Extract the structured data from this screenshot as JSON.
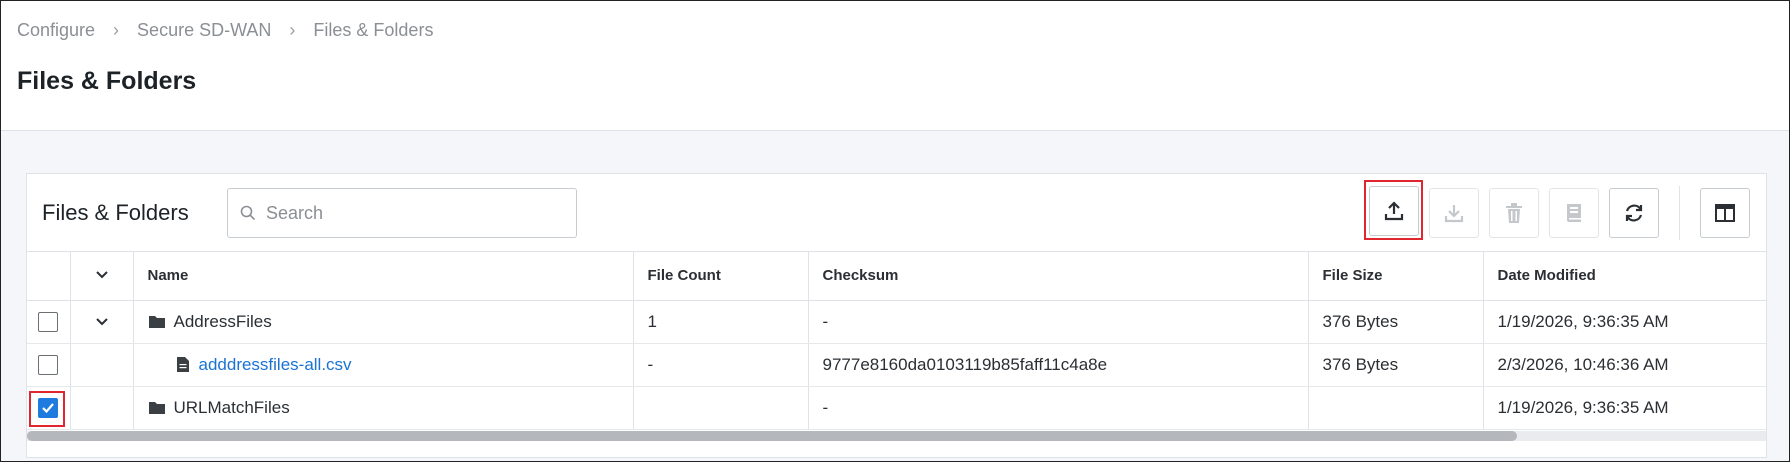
{
  "breadcrumb": [
    "Configure",
    "Secure SD-WAN",
    "Files & Folders"
  ],
  "page_title": "Files & Folders",
  "card": {
    "title": "Files & Folders",
    "search_placeholder": "Search"
  },
  "toolbar": {
    "buttons": [
      {
        "name": "upload",
        "icon": "upload-icon",
        "enabled": true,
        "highlighted": true
      },
      {
        "name": "download",
        "icon": "download-icon",
        "enabled": false
      },
      {
        "name": "delete",
        "icon": "trash-icon",
        "enabled": false
      },
      {
        "name": "view",
        "icon": "book-icon",
        "enabled": false
      },
      {
        "name": "refresh",
        "icon": "refresh-icon",
        "enabled": true
      },
      {
        "name": "columns",
        "icon": "column-layout-icon",
        "enabled": true
      }
    ]
  },
  "table": {
    "columns": [
      "Name",
      "File Count",
      "Checksum",
      "File Size",
      "Date Modified"
    ],
    "rows": [
      {
        "checked": false,
        "expandable": true,
        "type": "folder",
        "name": "AddressFiles",
        "file_count": "1",
        "checksum": "-",
        "file_size": "376 Bytes",
        "date_modified": "1/19/2026, 9:36:35 AM"
      },
      {
        "checked": false,
        "expandable": false,
        "type": "file",
        "name": "adddressfiles-all.csv",
        "file_count": "-",
        "checksum": "9777e8160da0103119b85faff11c4a8e",
        "file_size": "376 Bytes",
        "date_modified": "2/3/2026, 10:46:36 AM"
      },
      {
        "checked": true,
        "expandable": false,
        "type": "folder",
        "name": "URLMatchFiles",
        "file_count": "",
        "checksum": "-",
        "file_size": "",
        "date_modified": "1/19/2026, 9:36:35 AM"
      }
    ]
  },
  "colors": {
    "accent": "#1e7be0",
    "highlight": "#e0262f",
    "link": "#1a73d4"
  }
}
